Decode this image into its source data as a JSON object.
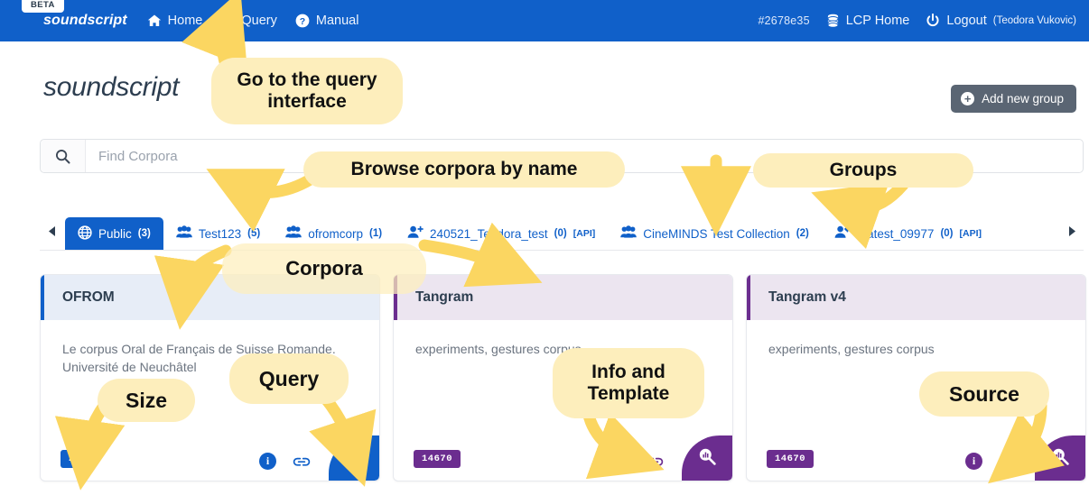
{
  "navbar": {
    "beta_label": "BETA",
    "brand": "soundscript",
    "left_items": [
      {
        "label": "Home",
        "icon": "home-icon"
      },
      {
        "label": "Query",
        "icon": "search-icon"
      },
      {
        "label": "Manual",
        "icon": "question-circle-icon"
      }
    ],
    "commit_hash": "#2678e35",
    "lcp_home_label": "LCP Home",
    "lcp_home_icon": "database-icon",
    "logout_label": "Logout",
    "logout_user": "(Teodora Vukovic)",
    "logout_icon": "power-icon"
  },
  "header": {
    "logo": "soundscript",
    "add_group_label": "Add new group",
    "add_group_icon": "plus-circle-icon"
  },
  "search": {
    "icon": "search-icon",
    "placeholder": "Find Corpora",
    "value": ""
  },
  "tabs": {
    "scroll_left_icon": "chevron-left-icon",
    "scroll_right_icon": "chevron-right-icon",
    "items": [
      {
        "label": "Public",
        "count": "(3)",
        "api": "",
        "icon": "globe-icon",
        "active": true
      },
      {
        "label": "Test123",
        "count": "(5)",
        "api": "",
        "icon": "group-icon",
        "active": false
      },
      {
        "label": "ofromcorp",
        "count": "(1)",
        "api": "",
        "icon": "group-icon",
        "active": false
      },
      {
        "label": "240521_Teodora_test",
        "count": "(0)",
        "api": "[API]",
        "icon": "user-plus-icon",
        "active": false
      },
      {
        "label": "CineMINDS Test Collection",
        "count": "(2)",
        "api": "",
        "icon": "group-icon",
        "active": false
      },
      {
        "label": "teatest_09977",
        "count": "(0)",
        "api": "[API]",
        "icon": "user-gear-icon",
        "active": false
      }
    ]
  },
  "cards": [
    {
      "title": "OFROM",
      "description": "Le corpus Oral de Français de Suisse Romande. Université de Neuchâtel",
      "size_badge": "2 M",
      "theme": "blue",
      "info_icon": "info-icon",
      "link_icon": "link-icon",
      "query_icon": "query-chart-search-icon"
    },
    {
      "title": "Tangram",
      "description": "experiments, gestures corpus",
      "size_badge": "14670",
      "theme": "purple",
      "info_icon": "info-icon",
      "link_icon": "link-icon",
      "query_icon": "query-chart-search-icon"
    },
    {
      "title": "Tangram v4",
      "description": "experiments, gestures corpus",
      "size_badge": "14670",
      "theme": "purple",
      "info_icon": "info-icon",
      "link_icon": "link-icon",
      "query_icon": "query-chart-search-icon"
    }
  ],
  "annotations": [
    {
      "text": "Go to the query interface"
    },
    {
      "text": "Browse corpora by name"
    },
    {
      "text": "Groups"
    },
    {
      "text": "Corpora"
    },
    {
      "text": "Size"
    },
    {
      "text": "Query"
    },
    {
      "text": "Info and Template"
    },
    {
      "text": "Source"
    }
  ],
  "colors": {
    "brand_blue": "#1060c9",
    "brand_purple": "#6b2d8f",
    "annotation_yellow": "#fdeebc",
    "arrow_yellow": "#fbd661",
    "add_group_gray": "#5a6573"
  }
}
